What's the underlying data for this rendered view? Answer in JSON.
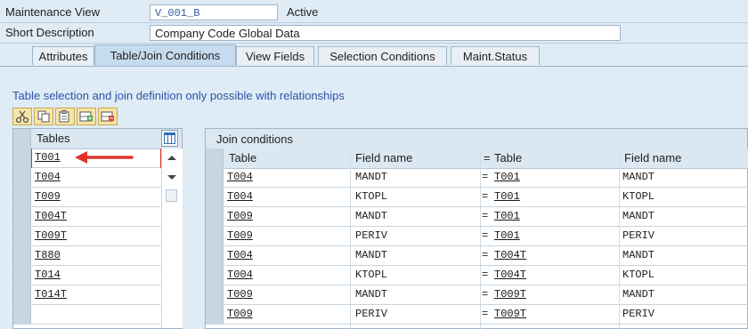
{
  "header": {
    "maintenance_view_label": "Maintenance View",
    "maintenance_view_value": "V_001_B",
    "maintenance_view_status": "Active",
    "short_description_label": "Short Description",
    "short_description_value": "Company Code Global Data"
  },
  "tabs": [
    {
      "label": "Attributes",
      "active": false
    },
    {
      "label": "Table/Join Conditions",
      "active": true
    },
    {
      "label": "View Fields",
      "active": false
    },
    {
      "label": "Selection Conditions",
      "active": false
    },
    {
      "label": "Maint.Status",
      "active": false
    }
  ],
  "info_text": "Table selection and join definition only possible with relationships",
  "toolbar_icons": [
    "cut-icon",
    "copy-icon",
    "paste-icon",
    "insert-row-icon",
    "delete-row-icon"
  ],
  "tables_panel": {
    "header": "Tables",
    "rows": [
      "T001",
      "T004",
      "T009",
      "T004T",
      "T009T",
      "T880",
      "T014",
      "T014T",
      ""
    ]
  },
  "join_panel": {
    "title": "Join conditions",
    "columns": [
      "Table",
      "Field name",
      "=",
      "Table",
      "Field name"
    ],
    "rows": [
      {
        "table1": "T004",
        "field1": "MANDT",
        "eq": "=",
        "table2": "T001",
        "field2": "MANDT"
      },
      {
        "table1": "T004",
        "field1": "KTOPL",
        "eq": "=",
        "table2": "T001",
        "field2": "KTOPL"
      },
      {
        "table1": "T009",
        "field1": "MANDT",
        "eq": "=",
        "table2": "T001",
        "field2": "MANDT"
      },
      {
        "table1": "T009",
        "field1": "PERIV",
        "eq": "=",
        "table2": "T001",
        "field2": "PERIV"
      },
      {
        "table1": "T004",
        "field1": "MANDT",
        "eq": "=",
        "table2": "T004T",
        "field2": "MANDT"
      },
      {
        "table1": "T004",
        "field1": "KTOPL",
        "eq": "=",
        "table2": "T004T",
        "field2": "KTOPL"
      },
      {
        "table1": "T009",
        "field1": "MANDT",
        "eq": "=",
        "table2": "T009T",
        "field2": "MANDT"
      },
      {
        "table1": "T009",
        "field1": "PERIV",
        "eq": "=",
        "table2": "T009T",
        "field2": "PERIV"
      }
    ]
  },
  "colors": {
    "accent_blue": "#2a54a8",
    "arrow_red": "#e0342b",
    "tab_active": "#c5dcef",
    "toolbar_yellow": "#f7e4a8"
  }
}
